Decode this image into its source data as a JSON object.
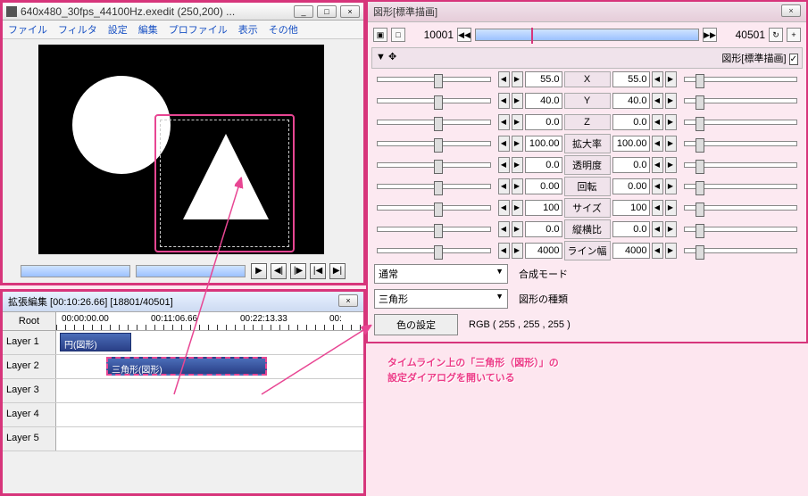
{
  "preview": {
    "title": "640x480_30fps_44100Hz.exedit (250,200) ...",
    "menu": [
      "ファイル",
      "フィルタ",
      "設定",
      "編集",
      "プロファイル",
      "表示",
      "その他"
    ]
  },
  "transport": {
    "play": "▶",
    "step_back": "◀|",
    "step_fwd": "|▶",
    "start": "|◀",
    "end": "▶|"
  },
  "timeline": {
    "title": "拡張編集 [00:10:26.66] [18801/40501]",
    "root": "Root",
    "ticks": [
      "00:00:00.00",
      "00:11:06.66",
      "00:22:13.33",
      "00:"
    ],
    "layers": [
      "Layer  1",
      "Layer  2",
      "Layer  3",
      "Layer  4",
      "Layer  5"
    ],
    "clips": {
      "circle": "円(図形)",
      "triangle": "三角形(図形)"
    }
  },
  "dialog": {
    "title": "図形[標準描画]",
    "section": "図形[標準描画]",
    "frame_start": "10001",
    "frame_end": "40501",
    "props": [
      {
        "l": "55.0",
        "label": "X",
        "r": "55.0"
      },
      {
        "l": "40.0",
        "label": "Y",
        "r": "40.0"
      },
      {
        "l": "0.0",
        "label": "Z",
        "r": "0.0"
      },
      {
        "l": "100.00",
        "label": "拡大率",
        "r": "100.00"
      },
      {
        "l": "0.0",
        "label": "透明度",
        "r": "0.0"
      },
      {
        "l": "0.00",
        "label": "回転",
        "r": "0.00"
      },
      {
        "l": "100",
        "label": "サイズ",
        "r": "100"
      },
      {
        "l": "0.0",
        "label": "縦横比",
        "r": "0.0"
      },
      {
        "l": "4000",
        "label": "ライン幅",
        "r": "4000"
      }
    ],
    "blend_mode": "通常",
    "blend_label": "合成モード",
    "shape_type": "三角形",
    "shape_label": "図形の種類",
    "color_btn": "色の設定",
    "color_val": "RGB ( 255 , 255 , 255 )"
  },
  "annotation": {
    "line1": "タイムライン上の「三角形（図形）」の",
    "line2": "設定ダイアログを開いている"
  }
}
